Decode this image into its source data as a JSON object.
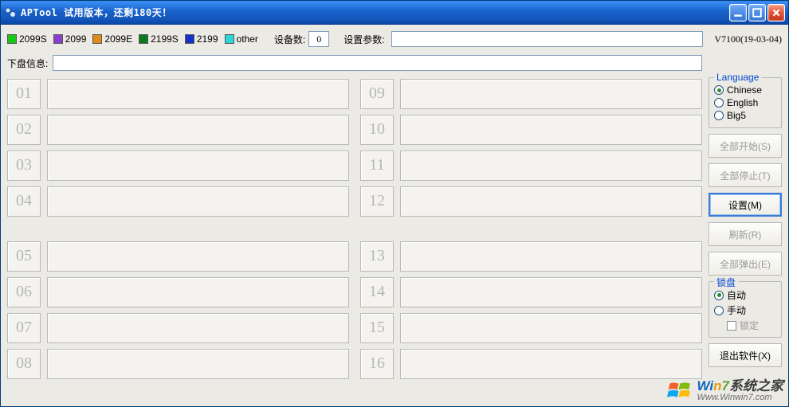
{
  "window": {
    "title": "APTool  试用版本，还剩180天！"
  },
  "legend": {
    "items": [
      {
        "label": "2099S",
        "color": "#18c816"
      },
      {
        "label": "2099",
        "color": "#8b3fc9"
      },
      {
        "label": "2099E",
        "color": "#e08a1a"
      },
      {
        "label": "2199S",
        "color": "#0a7a1c"
      },
      {
        "label": "2199",
        "color": "#1432c6"
      },
      {
        "label": "other",
        "color": "#2cd6d6"
      }
    ]
  },
  "top": {
    "device_count_label": "设备数:",
    "device_count_value": "0",
    "param_label": "设置参数:",
    "param_value": "",
    "version": "V7100(19-03-04)"
  },
  "row2": {
    "dlinfo_label": "下盘信息:",
    "dlinfo_value": ""
  },
  "slots": {
    "left": [
      "01",
      "02",
      "03",
      "04",
      "05",
      "06",
      "07",
      "08"
    ],
    "right": [
      "09",
      "10",
      "11",
      "12",
      "13",
      "14",
      "15",
      "16"
    ]
  },
  "side": {
    "lang_title": "Language",
    "lang": {
      "chinese": "Chinese",
      "english": "English",
      "big5": "Big5",
      "selected": "chinese"
    },
    "btn_start": "全部开始(S)",
    "btn_stop": "全部停止(T)",
    "btn_set": "设置(M)",
    "btn_refresh": "刷新(R)",
    "btn_eject": "全部弹出(E)",
    "lock_title": "锁盘",
    "lock": {
      "auto": "自动",
      "manual": "手动",
      "lock": "锁定",
      "selected": "auto"
    },
    "btn_exit": "退出软件(X)"
  },
  "watermark": {
    "line1_a": "Wi",
    "line1_b": "n",
    "line1_c": "7",
    "line1_d": "系统之家",
    "line2": "Www.Winwin7.com"
  }
}
